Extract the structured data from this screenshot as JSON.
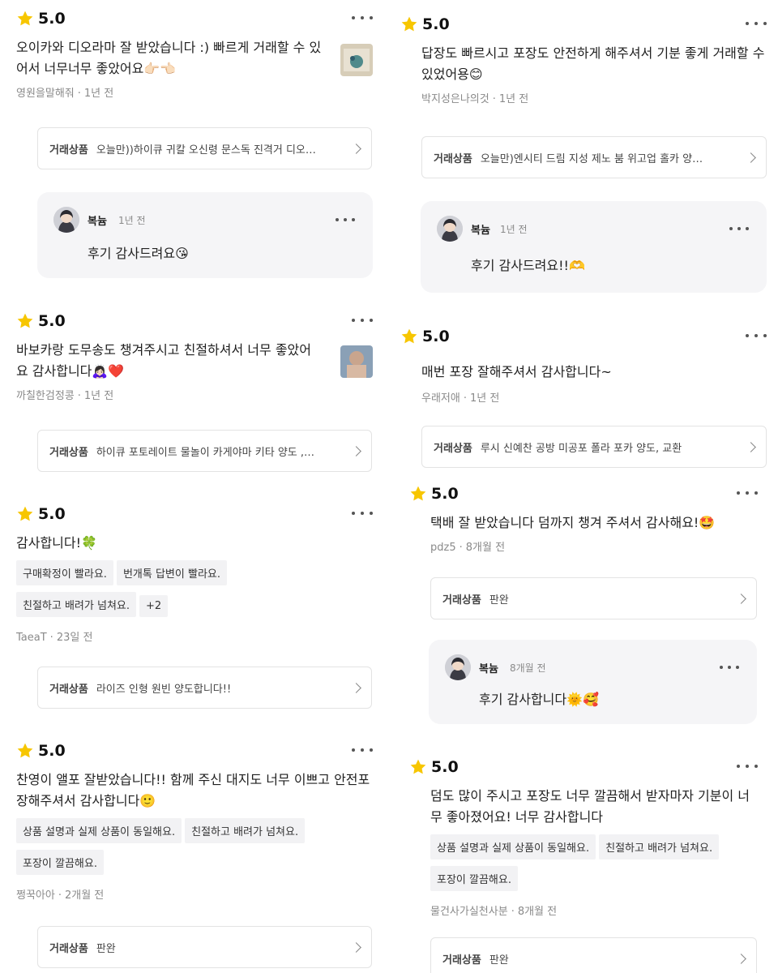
{
  "deal_label": "거래상품",
  "reviews": [
    {
      "score": "5.0",
      "text": "오이카와 디오라마 잘 받았습니다 :) 빠르게 거래할 수 있어서 너무너무 좋았어요",
      "emoji": "👉🏻👈🏻",
      "author": "영원을말해줘",
      "time": "1년 전",
      "deal": "오늘만))하이큐 귀칼 오신령 문스독 진격거 디오…",
      "reply": {
        "name": "복늄",
        "time": "1년 전",
        "text": "후기 감사드려요",
        "emoji": "😘"
      }
    },
    {
      "score": "5.0",
      "text": "바보카랑 도무송도 챙겨주시고 친절하셔서 너무 좋았어요 감사합니다",
      "emoji": "🙇🏻‍♀️❤️",
      "author": "까칠한검정콩",
      "time": "1년 전",
      "deal": "하이큐 포토레이트 물놀이 카게야마 키타 양도 ,…"
    },
    {
      "score": "5.0",
      "text": "감사합니다!",
      "emoji": "🍀",
      "tags": [
        "구매확정이 빨라요.",
        "번개톡 답변이 빨라요.",
        "친절하고 배려가 넘쳐요.",
        "+2"
      ],
      "author": "TaeaT",
      "time": "23일 전",
      "deal": "라이즈 인형 원빈 양도합니다!!"
    },
    {
      "score": "5.0",
      "text": "찬영이 앨포 잘받았습니다!! 함께 주신 대지도 너무 이쁘고 안전포장해주셔서 감사합니다",
      "emoji": "🙂",
      "tags": [
        "상품 설명과 실제 상품이 동일해요.",
        "친절하고 배려가 넘쳐요.",
        "포장이 깔끔해요."
      ],
      "author": "쩡꾹아아",
      "time": "2개월 전",
      "deal": "판완"
    },
    {
      "score": "5.0",
      "text": "답장도 빠르시고 포장도 안전하게 해주셔서 기분 좋게 거래할 수 있었어용",
      "emoji": "😊",
      "author": "박지성은나의것",
      "time": "1년 전",
      "deal": "오늘만)엔시티 드림 지성 제노 붐 위고업 홀카 양…",
      "reply": {
        "name": "복늄",
        "time": "1년 전",
        "text": "후기 감사드려요!!",
        "emoji": "🫶"
      }
    },
    {
      "score": "5.0",
      "text": "매번 포장 잘해주셔서 감사합니다~",
      "emoji": "",
      "author": "우래저애",
      "time": "1년 전",
      "deal": "루시 신예찬 공방 미공포 폴라 포카 양도, 교환"
    },
    {
      "score": "5.0",
      "text": "택배 잘 받았습니다 덤까지 챙겨 주셔서 감사해요!",
      "emoji": "🤩",
      "author": "pdz5",
      "time": "8개월 전",
      "deal": "판완",
      "reply": {
        "name": "복늄",
        "time": "8개월 전",
        "text": "후기 감사합니다",
        "emoji": "🌞🥰"
      }
    },
    {
      "score": "5.0",
      "text": "덤도 많이 주시고 포장도 너무 깔끔해서 받자마자 기분이 너무 좋아졌어요! 너무 감사합니다",
      "emoji": "",
      "tags": [
        "상품 설명과 실제 상품이 동일해요.",
        "친절하고 배려가 넘쳐요.",
        "포장이 깔끔해요."
      ],
      "author": "물건사가실천사분",
      "time": "8개월 전",
      "deal": "판완"
    }
  ]
}
